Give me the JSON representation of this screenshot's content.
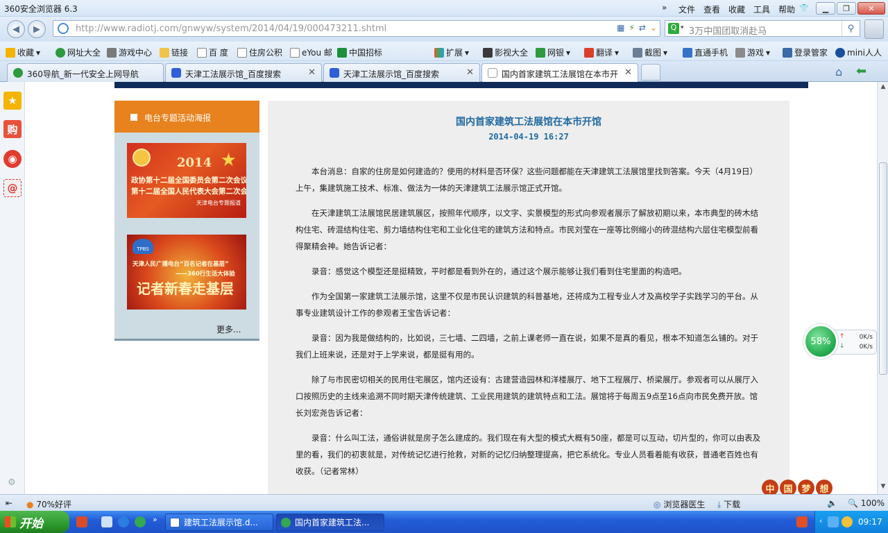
{
  "window": {
    "title": "360安全浏览器 6.3",
    "menu": [
      "文件",
      "查看",
      "收藏",
      "工具",
      "帮助"
    ]
  },
  "address": {
    "url": "http://www.radiotj.com/gnwyw/system/2014/04/19/000473211.shtml",
    "search_text": "3万中国团取消赴马"
  },
  "bookmarks": {
    "left": [
      {
        "label": "收藏"
      },
      {
        "label": "网址大全"
      },
      {
        "label": "游戏中心"
      },
      {
        "label": "链接"
      },
      {
        "label": "百 度"
      },
      {
        "label": "住房公积"
      },
      {
        "label": "eYou 邮"
      },
      {
        "label": "中国招标"
      }
    ],
    "right": [
      {
        "label": "扩展"
      },
      {
        "label": "影视大全"
      },
      {
        "label": "网银"
      },
      {
        "label": "翻译"
      },
      {
        "label": "截图"
      },
      {
        "label": "直通手机"
      },
      {
        "label": "游戏"
      },
      {
        "label": "登录管家"
      },
      {
        "label": "mini人人"
      }
    ]
  },
  "tabs": [
    {
      "label": "360导航_新一代安全上网导航"
    },
    {
      "label": "天津工法展示馆_百度搜索"
    },
    {
      "label": "天津工法展示馆_百度搜索"
    },
    {
      "label": "国内首家建筑工法展馆在本市开"
    }
  ],
  "left_column": {
    "heading": "电台专题活动海报",
    "poster1": {
      "year": "2014",
      "line1": "政协第十二届全国委员会第二次会议",
      "line2": "第十二届全国人民代表大会第二次会议",
      "caption": "天津电台专题报道"
    },
    "poster2": {
      "logo": "TPBS",
      "line1": "天津人民广播电台“百名记者在基层”",
      "line2": "——360行生活大体验",
      "big": "记者新春走基层"
    },
    "more": "更多..."
  },
  "article": {
    "title": "国内首家建筑工法展馆在本市开馆",
    "date": "2014-04-19  16:27",
    "paragraphs": [
      "本台消息：自家的住房是如何建造的？使用的材料是否环保？这些问题都能在天津建筑工法展馆里找到答案。今天（4月19日）上午，集建筑施工技术、标准、做法为一体的天津建筑工法展示馆正式开馆。",
      "在天津建筑工法展馆民居建筑展区，按照年代顺序，以文字、实景模型的形式向参观者展示了解放初期以来，本市典型的砖木结构住宅、砖混结构住宅、剪力墙结构住宅和工业化住宅的建筑方法和特点。市民刘莹在一座等比例缩小的砖混结构六层住宅模型前看得聚精会神。她告诉记者：",
      "录音：感觉这个模型还是挺精致，平时都是看到外在的，通过这个展示能够让我们看到住宅里面的构造吧。",
      "作为全国第一家建筑工法展示馆，这里不仅是市民认识建筑的科普基地，还将成为工程专业人才及高校学子实践学习的平台。从事专业建筑设计工作的参观者王宝告诉记者：",
      "录音：因为我是做结构的，比如说，三七墙、二四墙，之前上课老师一直在说，如果不是真的看见，根本不知道怎么铺的。对于我们上班来说，还是对于上学来说，都是挺有用的。",
      "除了与市民密切相关的民用住宅展区，馆内还设有：古建营造园林和洋楼展厅、地下工程展厅、桥梁展厅。参观者可以从展厅入口按照历史的主线来追溯不同时期天津传统建筑、工业民用建筑的建筑特点和工法。展馆将于每周五9点至16点向市民免费开放。馆长刘宏尧告诉记者：",
      "录音：什么叫工法，通俗讲就是房子怎么建成的。我们现在有大型的模式大概有50座，都是可以互动，切片型的，你可以由表及里的看，我们的初衷就是，对传统记忆进行抢救，对新的记忆归纳整理提高，把它系统化。专业人员看着能有收获，普通老百姓也有收获。（记者常林）"
    ]
  },
  "speed_widget": {
    "percent": "58%",
    "up": "0K/s",
    "down": "0K/s"
  },
  "decoration": [
    "中",
    "国",
    "梦",
    "想"
  ],
  "status": {
    "rating": "70%好评",
    "doctor": "浏览器医生",
    "download": "下载",
    "zoom": "100%"
  },
  "taskbar": {
    "start": "开始",
    "tasks": [
      {
        "label": "建筑工法展示馆.d..."
      },
      {
        "label": "国内首家建筑工法..."
      }
    ],
    "clock": "09:17"
  },
  "colors": {
    "article_title": "#1f6aa0",
    "left_header": "#e8821e",
    "page_header": "#1d4a8c"
  }
}
